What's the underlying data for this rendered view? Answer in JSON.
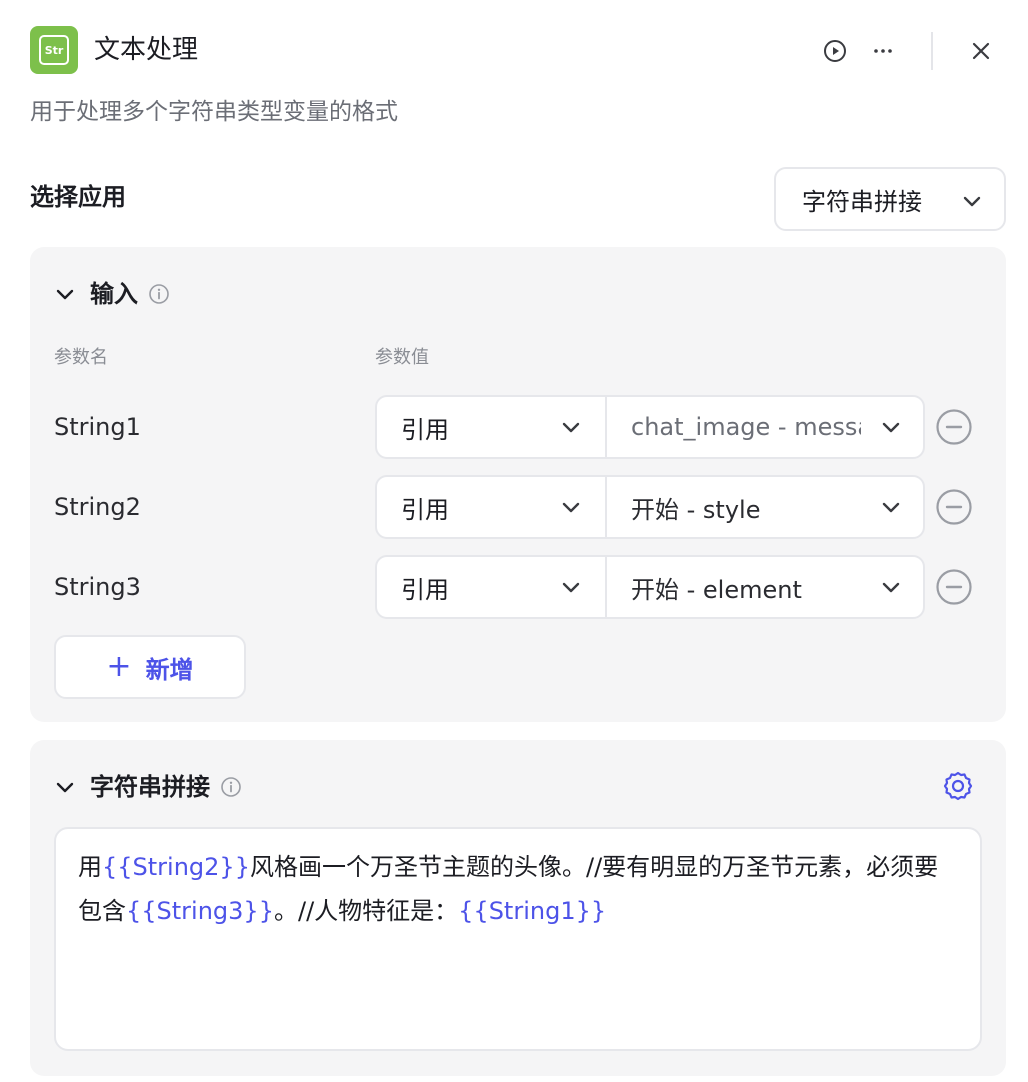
{
  "header": {
    "icon_text": "Str",
    "title": "文本处理",
    "subtitle": "用于处理多个字符串类型变量的格式"
  },
  "app_select": {
    "label": "选择应用",
    "value": "字符串拼接"
  },
  "input_section": {
    "title": "输入",
    "col_name": "参数名",
    "col_value": "参数值",
    "rows": [
      {
        "name": "String1",
        "ref_type": "引用",
        "ref_value": "chat_image - message"
      },
      {
        "name": "String2",
        "ref_type": "引用",
        "ref_value": "开始 - style"
      },
      {
        "name": "String3",
        "ref_type": "引用",
        "ref_value": "开始 - element"
      }
    ],
    "add_label": "新增"
  },
  "concat_section": {
    "title": "字符串拼接",
    "template_segments": [
      {
        "text": "用",
        "var": false
      },
      {
        "text": "{{String2}}",
        "var": true
      },
      {
        "text": "风格画一个万圣节主题的头像。//要有明显的万圣节元素，必须要包含",
        "var": false
      },
      {
        "text": "{{String3}}",
        "var": true
      },
      {
        "text": "。//人物特征是：",
        "var": false
      },
      {
        "text": "{{String1}}",
        "var": true
      }
    ]
  },
  "colors": {
    "accent": "#4d53e8",
    "icon_bg": "#7dc04b",
    "panel_bg": "#f5f5f6"
  },
  "icons": [
    "run-icon",
    "more-icon",
    "close-icon",
    "chevron-down-icon",
    "info-icon",
    "remove-icon",
    "plus-icon",
    "gear-icon"
  ]
}
